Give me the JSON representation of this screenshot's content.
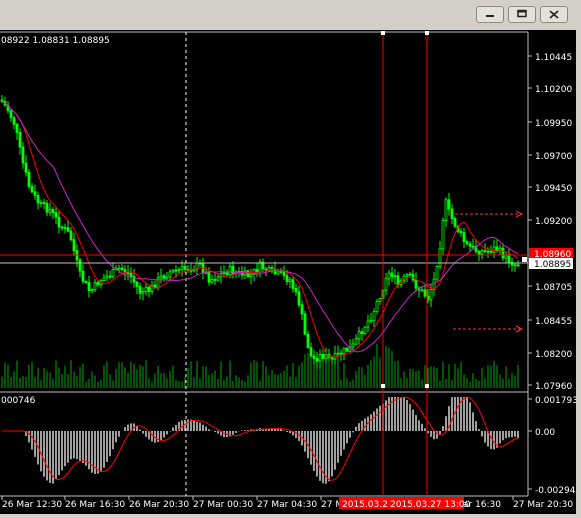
{
  "window": {
    "buttons": [
      {
        "name": "minimize",
        "icon": "minimize-icon"
      },
      {
        "name": "restore",
        "icon": "restore-icon"
      },
      {
        "name": "close",
        "icon": "close-icon"
      }
    ]
  },
  "chart": {
    "ohlc_text": "08922 1.08831 1.08895",
    "y_ticks": [
      "1.10445",
      "1.10200",
      "1.09950",
      "1.09700",
      "1.09450",
      "1.09200",
      "1.08705",
      "1.08455",
      "1.08200",
      "1.07960"
    ],
    "bid_price_tag": "1.08895",
    "red_price_tag": "1.08960",
    "x_ticks": [
      "26 Mar 12:30",
      "26 Mar 16:30",
      "26 Mar 20:30",
      "27 Mar 00:30",
      "27 Mar 04:30",
      "27 M",
      "ar 16:30",
      "27 Mar 20:30"
    ],
    "x_tags": [
      "2015.03.27 10:00",
      "2015.03.27 13:00"
    ],
    "osc_label": "000746",
    "osc_ticks": [
      "0.001793",
      "0.00",
      "-0.002949"
    ],
    "colors": {
      "bull_candle": "#00ff00",
      "bear_candle": "#00ff00",
      "ma_fast": "#ff0000",
      "ma_slow": "#cc22cc",
      "price_line": "#c0c0c0",
      "red_line": "#ff0000",
      "histogram": "#c8c8c8",
      "volume": "#00aa00"
    }
  }
}
